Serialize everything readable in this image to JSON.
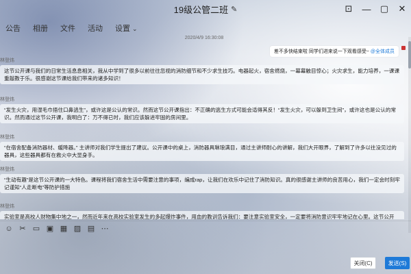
{
  "window": {
    "title": "19级公管二班",
    "controls": [
      "⊡",
      "—",
      "▢",
      "✕"
    ]
  },
  "tabs": [
    {
      "label": "公告"
    },
    {
      "label": "相册"
    },
    {
      "label": "文件"
    },
    {
      "label": "活动"
    },
    {
      "label": "设置"
    }
  ],
  "chat": {
    "timestamp": "2020/4/9 16:30:08",
    "outgoing": {
      "text": "差不多快结束啦 同学们进来说一下观看感受~ ",
      "mention": "@全体成员"
    },
    "messages": [
      {
        "sender": "林登炜",
        "text": "这节公开课与我们的日常生活息息相关，我从中学到了很多以前往往忽视的消防细节和不少求生技巧。电器起火，宿舍燃烧，一幕幕触目惊心；火灾求生，能力培养，一课课重敲教于乐。很感谢这节课给我们带来的诸多知识！"
      },
      {
        "sender": "林登炜",
        "text": "“发生火灾，用湿毛巾捂住口鼻逃生”，或许这是公认的常识。然而这节公开课指出：不正确的逃生方式可能会适得其反！“发生火灾，可以躲到卫生间”，或许这也是公认的常识。然而通过这节公开课，我明白了：万不得已时，我们应该躲进牢固的房间里。"
      },
      {
        "sender": "林登炜",
        "text": "“在宿舍配备消防器材、缓降器。” 主讲师对我们学生提出了建议。公开课中的桌上，消防器具琳琅满目，通过主讲师耐心的讲解，我们大开眼界，了解到了许多以往没见过的器具，这些器具都有在救火中大显身手。"
      },
      {
        "sender": "林登炜",
        "text": "“生动有趣”是这节公开课的一大特色。课程将我们宿舍生活中需要注意的事项，编成rap，让我们在欢乐中记住了消防知识。真的很感谢主讲师的良苦用心，我们一定会时刻牢记谨知“人走断电”等防护措施"
      },
      {
        "sender": "林登炜",
        "text": "实验室是高校人财物集中地之一，然而近年来在高校实验室发生的多起爆炸事件，用血的教训告诉我们：要注意实验室安全，一定要将消防意识牢牢地记在心里。这节公开"
      }
    ]
  },
  "toolbar": {
    "icons": [
      "☺",
      "✂",
      "▭",
      "▣",
      "▦",
      "▨",
      "▤",
      "⋯"
    ]
  },
  "buttons": {
    "close": "关闭(C)",
    "send": "发送(S)"
  },
  "colors": {
    "accent": "#1e7ad8",
    "bubble": "#f5f7fa"
  }
}
